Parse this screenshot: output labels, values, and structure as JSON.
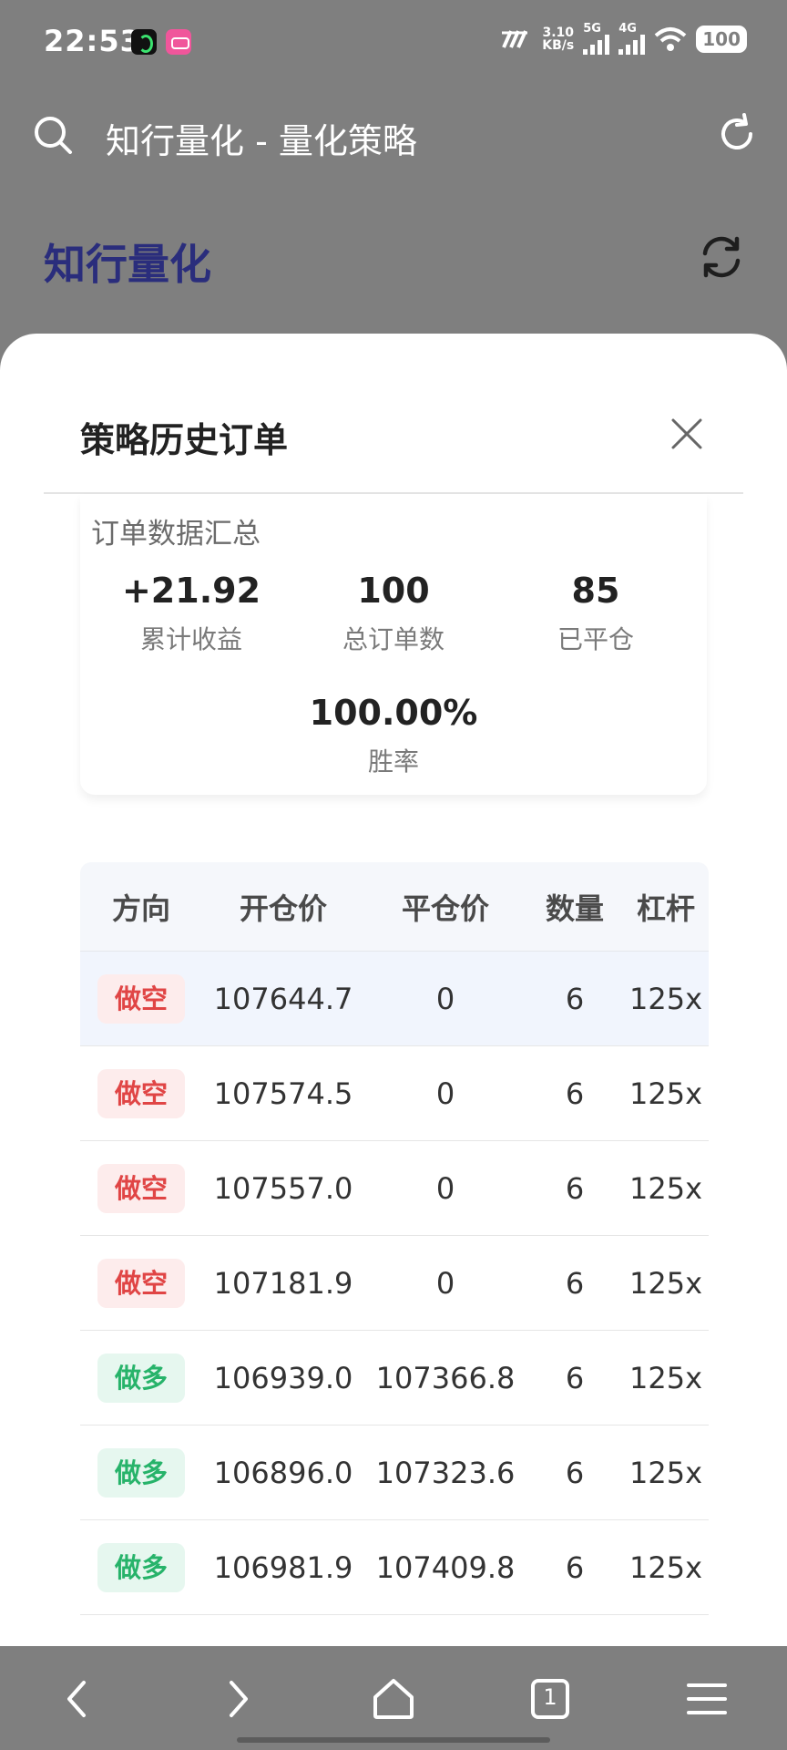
{
  "status_bar": {
    "time": "22:53",
    "net_speed_value": "3.10",
    "net_speed_unit": "KB/s",
    "signal1_label": "5G",
    "signal2_label": "4G",
    "battery": "100"
  },
  "browser": {
    "title": "知行量化 - 量化策略"
  },
  "page": {
    "brand": "知行量化"
  },
  "modal": {
    "title": "策略历史订单",
    "summary": {
      "heading": "订单数据汇总",
      "stats": [
        {
          "value": "+21.92",
          "label": "累计收益"
        },
        {
          "value": "100",
          "label": "总订单数"
        },
        {
          "value": "85",
          "label": "已平仓"
        },
        {
          "value": "100.00%",
          "label": "胜率"
        }
      ]
    },
    "table": {
      "headers": [
        "方向",
        "开仓价",
        "平仓价",
        "数量",
        "杠杆"
      ],
      "rows": [
        {
          "direction": "做空",
          "type": "short",
          "open": "107644.7",
          "close": "0",
          "qty": "6",
          "leverage": "125x"
        },
        {
          "direction": "做空",
          "type": "short",
          "open": "107574.5",
          "close": "0",
          "qty": "6",
          "leverage": "125x"
        },
        {
          "direction": "做空",
          "type": "short",
          "open": "107557.0",
          "close": "0",
          "qty": "6",
          "leverage": "125x"
        },
        {
          "direction": "做空",
          "type": "short",
          "open": "107181.9",
          "close": "0",
          "qty": "6",
          "leverage": "125x"
        },
        {
          "direction": "做多",
          "type": "long",
          "open": "106939.0",
          "close": "107366.8",
          "qty": "6",
          "leverage": "125x"
        },
        {
          "direction": "做多",
          "type": "long",
          "open": "106896.0",
          "close": "107323.6",
          "qty": "6",
          "leverage": "125x"
        },
        {
          "direction": "做多",
          "type": "long",
          "open": "106981.9",
          "close": "107409.8",
          "qty": "6",
          "leverage": "125x"
        }
      ]
    }
  },
  "bottom_nav": {
    "tab_count": "1",
    "icons": [
      "back-icon",
      "forward-icon",
      "home-icon",
      "tabs-icon",
      "menu-icon"
    ]
  },
  "colors": {
    "brand": "#2a2d7c",
    "short_text": "#e04545",
    "short_bg": "#fdecec",
    "long_text": "#27b36a",
    "long_bg": "#e6f7ef",
    "overlay": "#7f7f7f"
  }
}
